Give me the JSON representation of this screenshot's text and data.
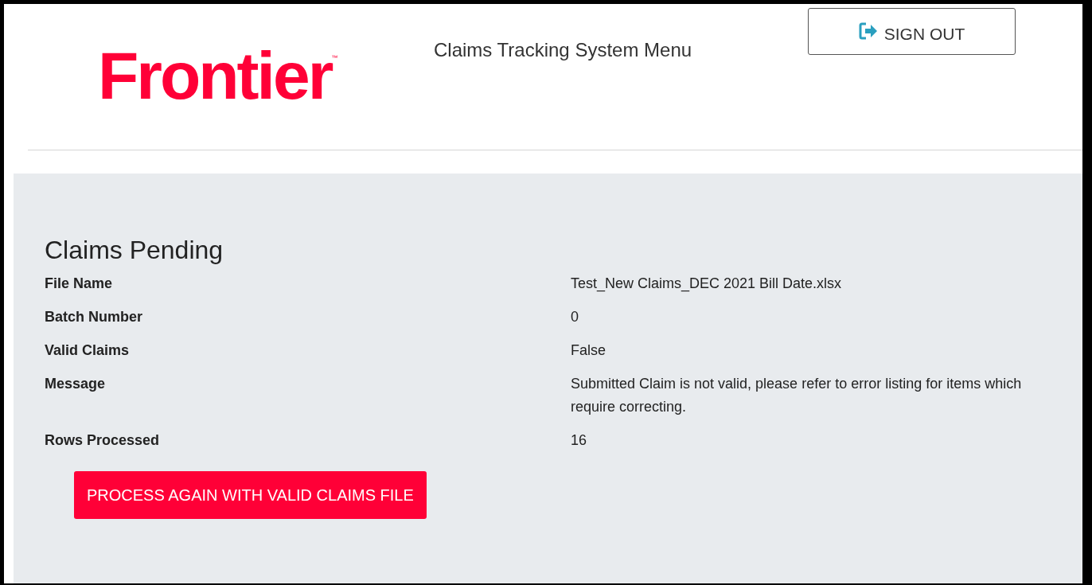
{
  "header": {
    "logo": {
      "text": "Frontier",
      "trademark": "™"
    },
    "title": "Claims Tracking System Menu",
    "sign_out": "SIGN OUT"
  },
  "panel": {
    "heading": "Claims Pending",
    "fields": [
      {
        "label": "File Name",
        "value": "Test_New Claims_DEC 2021 Bill Date.xlsx"
      },
      {
        "label": "Batch Number",
        "value": "0"
      },
      {
        "label": "Valid Claims",
        "value": "False"
      },
      {
        "label": "Message",
        "value": "Submitted Claim is not valid, please refer to error listing for items which require correcting."
      },
      {
        "label": "Rows Processed",
        "value": "16"
      }
    ],
    "action_button": "PROCESS AGAIN WITH VALID CLAIMS FILE"
  }
}
